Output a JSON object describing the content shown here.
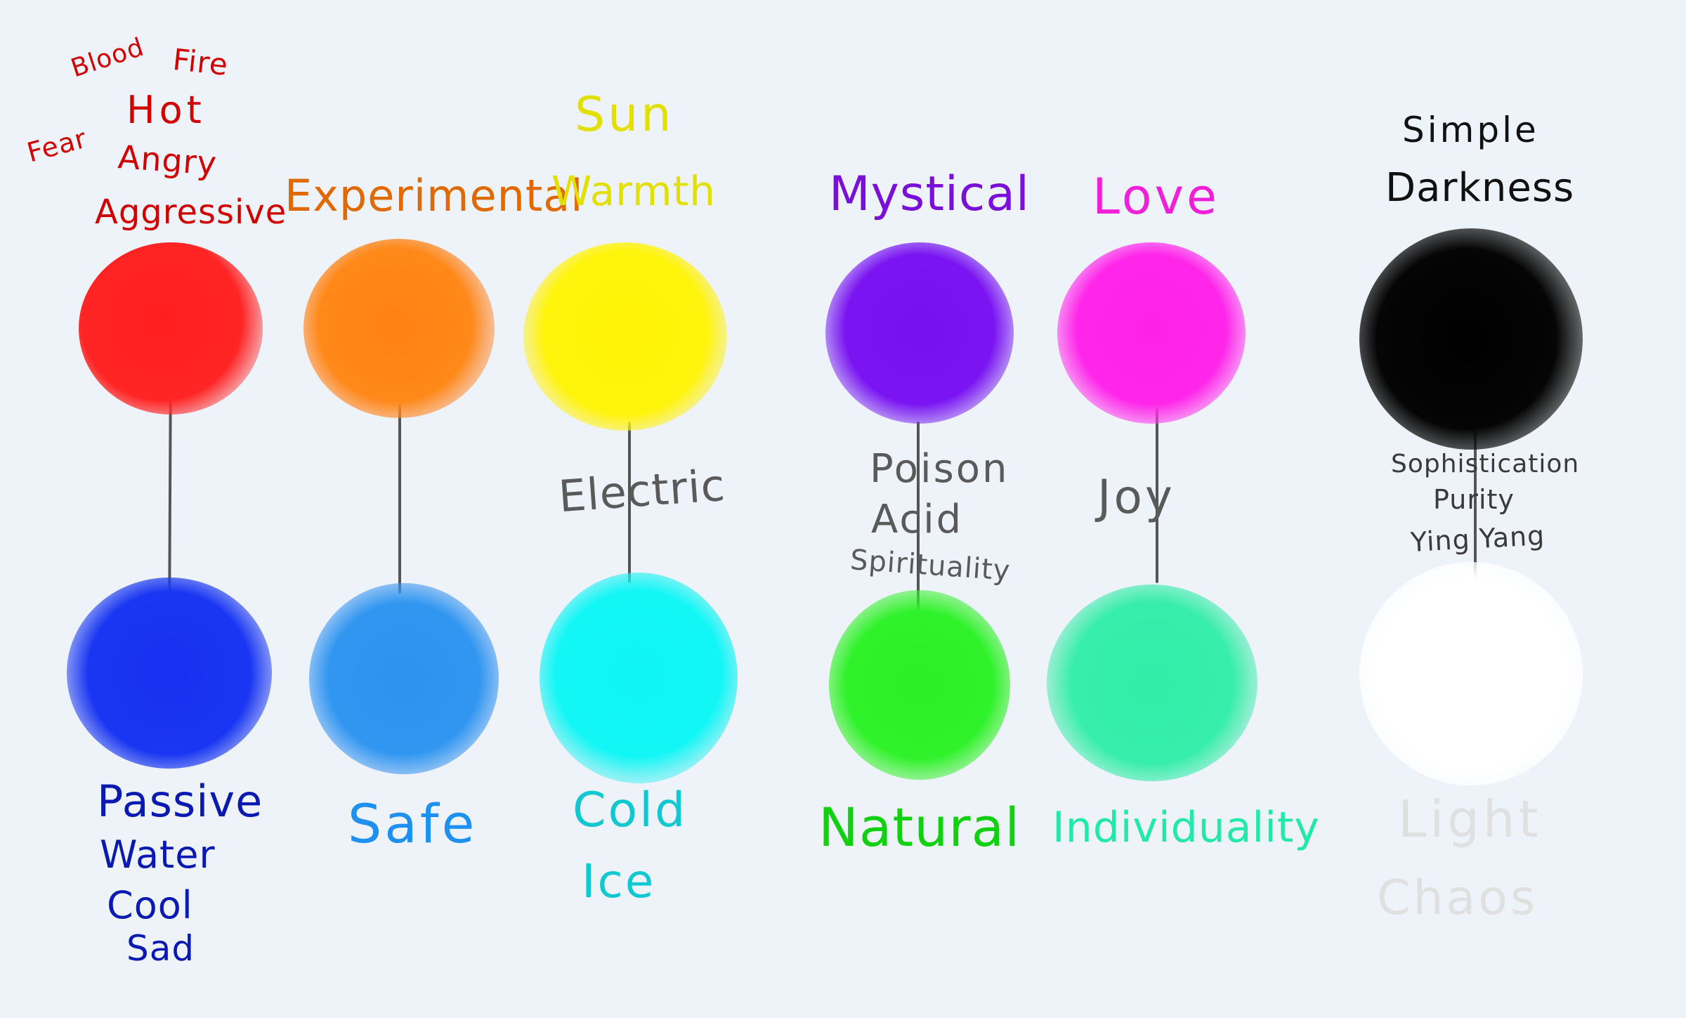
{
  "pairs": [
    {
      "id": "red-blue",
      "top": {
        "color": "#ff2020",
        "words": [
          "Blood",
          "Fire",
          "Fear",
          "Hot",
          "Angry",
          "Aggressive"
        ]
      },
      "middle": {
        "words": []
      },
      "bottom": {
        "color": "#1a3af0",
        "words": [
          "Passive",
          "Water",
          "Cool",
          "Sad"
        ]
      }
    },
    {
      "id": "orange-lightblue",
      "top": {
        "color": "#ff8418",
        "words": [
          "Experimental"
        ]
      },
      "middle": {
        "words": []
      },
      "bottom": {
        "color": "#2f96f0",
        "words": [
          "Safe"
        ]
      }
    },
    {
      "id": "yellow-cyan",
      "top": {
        "color": "#fff20a",
        "words": [
          "Sun",
          "Warmth"
        ]
      },
      "middle": {
        "words": [
          "Electric"
        ]
      },
      "bottom": {
        "color": "#12f6f6",
        "words": [
          "Cold",
          "Ice"
        ]
      }
    },
    {
      "id": "purple-green",
      "top": {
        "color": "#7a12f2",
        "words": [
          "Mystical"
        ]
      },
      "middle": {
        "words": [
          "Poison",
          "Acid",
          "Spirituality"
        ]
      },
      "bottom": {
        "color": "#2ff22a",
        "words": [
          "Natural"
        ]
      }
    },
    {
      "id": "pink-teal",
      "top": {
        "color": "#ff22e8",
        "words": [
          "Love"
        ]
      },
      "middle": {
        "words": [
          "Joy"
        ]
      },
      "bottom": {
        "color": "#35eeaa",
        "words": [
          "Individuality"
        ]
      }
    },
    {
      "id": "black-white",
      "top": {
        "color": "#050505",
        "words": [
          "Simple",
          "Darkness"
        ]
      },
      "middle": {
        "words": [
          "Sophistication",
          "Purity",
          "Ying Yang"
        ]
      },
      "bottom": {
        "color": "#ffffff",
        "words": [
          "Light",
          "Chaos"
        ]
      }
    }
  ],
  "text_colors": {
    "red": "#d00000",
    "orange": "#e06a00",
    "yellow": "#e2e000",
    "purple": "#7a10d8",
    "pink": "#f020d8",
    "black": "#111111",
    "gray": "#5a5a5a",
    "navy": "#0a1ab0",
    "sky": "#1e90f0",
    "cyan": "#10c8d0",
    "green": "#10d010",
    "mint": "#22e8a8",
    "light-gray": "#e0e0e0"
  }
}
